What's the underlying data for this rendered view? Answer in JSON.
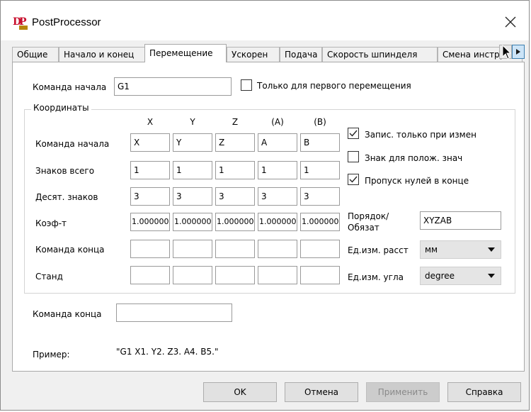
{
  "window": {
    "title": "PostProcessor",
    "logo_text": "DP"
  },
  "tabs": [
    {
      "label": "Общие",
      "active": false
    },
    {
      "label": "Начало и конец",
      "active": false
    },
    {
      "label": "Перемещение",
      "active": true
    },
    {
      "label": "Ускорен",
      "active": false
    },
    {
      "label": "Подача",
      "active": false
    },
    {
      "label": "Скорость шпинделя",
      "active": false
    },
    {
      "label": "Смена инструмен",
      "active": false
    }
  ],
  "top": {
    "start_command_label": "Команда начала",
    "start_command_value": "G1",
    "first_move_only_label": "Только для первого перемещения",
    "first_move_only_checked": false
  },
  "coords": {
    "group_title": "Координаты",
    "columns": [
      "X",
      "Y",
      "Z",
      "(A)",
      "(B)"
    ],
    "rows": [
      {
        "label": "Команда начала",
        "values": [
          "X",
          "Y",
          "Z",
          "A",
          "B"
        ]
      },
      {
        "label": "Знаков всего",
        "values": [
          "1",
          "1",
          "1",
          "1",
          "1"
        ]
      },
      {
        "label": "Десят. знаков",
        "values": [
          "3",
          "3",
          "3",
          "3",
          "3"
        ]
      },
      {
        "label": "Коэф-т",
        "values": [
          "1.000000",
          "1.000000",
          "1.000000",
          "1.000000",
          "1.000000"
        ]
      },
      {
        "label": "Команда конца",
        "values": [
          "",
          "",
          "",
          "",
          ""
        ]
      },
      {
        "label": "Станд",
        "values": [
          "",
          "",
          "",
          "",
          ""
        ]
      }
    ],
    "options": [
      {
        "label": "Запис. только при измен",
        "checked": true
      },
      {
        "label": "Знак для полож. знач",
        "checked": false
      },
      {
        "label": "Пропуск нулей в конце",
        "checked": true
      }
    ],
    "order_label_1": "Порядок/",
    "order_label_2": "Обязат",
    "order_value": "XYZAB",
    "dist_unit_label": "Ед.изм. расст",
    "dist_unit_value": "мм",
    "angle_unit_label": "Ед.изм. угла",
    "angle_unit_value": "degree"
  },
  "bottom": {
    "end_command_label": "Команда конца",
    "end_command_value": "",
    "example_label": "Пример:",
    "example_value": "\"G1 X1. Y2. Z3. A4. B5.\""
  },
  "buttons": {
    "ok": "OK",
    "cancel": "Отмена",
    "apply": "Применить",
    "help": "Справка"
  },
  "colors": {
    "logo_red": "#c8102e",
    "logo_gold": "#b8860b",
    "disabled_text": "#8a8a8a"
  }
}
